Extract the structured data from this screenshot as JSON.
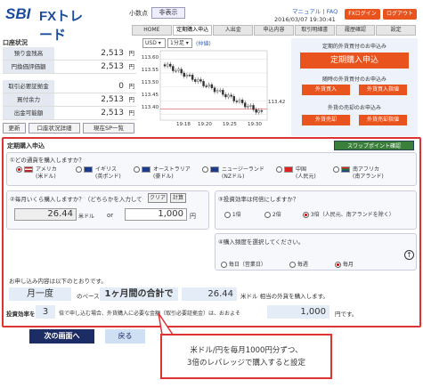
{
  "header": {
    "logo_sbi": "SBI",
    "logo_fx": "FXトレード",
    "decimal_label": "小数点",
    "decimal_toggle": "非表示",
    "links": "マニュアル | FAQ",
    "datetime": "2016/03/07 19:30:41",
    "red_btn1": "FXログイン",
    "red_btn2": "ログアウト"
  },
  "nav": {
    "tabs": [
      "HOME",
      "定期購入申込",
      "入出金",
      "申込内容",
      "取引明細書",
      "履歴確認",
      "設定"
    ]
  },
  "account": {
    "title": "口座状況",
    "rows": [
      {
        "label": "預り金残高",
        "value": "2,513",
        "unit": "円"
      },
      {
        "label": "円換価評価額",
        "value": "2,513",
        "unit": "円"
      },
      {
        "label": "取引必要証拠金",
        "value": "0",
        "unit": "円"
      },
      {
        "label": "買付余力",
        "value": "2,513",
        "unit": "円"
      },
      {
        "label": "出金可能額",
        "value": "2,513",
        "unit": "円"
      }
    ],
    "btn_update": "更新",
    "btn_details": "口座状況詳細",
    "btn_sp": "現在SP一覧"
  },
  "chart": {
    "pair": "USD",
    "period": "1分足",
    "mode": "(仲値)",
    "y_ticks": [
      "113.60",
      "113.55",
      "113.50",
      "113.45",
      "113.40"
    ],
    "x_ticks": [
      "19:18",
      "19:20",
      "19:25",
      "19:30"
    ],
    "last_price": "113.42"
  },
  "chart_data": {
    "type": "candlestick",
    "ylim": [
      113.38,
      113.63
    ],
    "y_ticks": [
      113.4,
      113.45,
      113.5,
      113.55,
      113.6
    ],
    "x_ticks": [
      "19:18",
      "19:20",
      "19:25",
      "19:30"
    ],
    "last_price": 113.42
  },
  "right_panel": {
    "title1": "定期的外貨買付のお申込み",
    "big_btn": "定期購入申込",
    "title2": "随時の外貨買付のお申込み",
    "btn_buy": "外貨買入",
    "btn_limit": "外貨買入指値",
    "title3": "外貨の売却のお申込み",
    "btn_sell": "外貨売却",
    "btn_sell_limit": "外貨売却指値"
  },
  "form": {
    "section_title": "定期購入申込",
    "swap_btn": "スワップポイント確認",
    "q1": "①どの通貨を購入しますか？",
    "currencies": [
      {
        "name": "アメリカ",
        "sub": "(米ドル)",
        "selected": true
      },
      {
        "name": "イギリス",
        "sub": "(英ポンド)",
        "selected": false
      },
      {
        "name": "オーストラリア",
        "sub": "(豪ドル)",
        "selected": false
      },
      {
        "name": "ニュージーランド",
        "sub": "(NZドル)",
        "selected": false
      },
      {
        "name": "中国",
        "sub": "(人民元)",
        "selected": false
      },
      {
        "name": "南アフリカ",
        "sub": "(南アランド)",
        "selected": false
      }
    ],
    "q2": "②毎月いくら購入しますか？（どちらかを入力してください）",
    "clear_btn": "クリア",
    "calc_btn": "計算",
    "amount_usd": "26.44",
    "usd_unit": "米ドル",
    "or": "or",
    "amount_jpy": "1,000",
    "jpy_unit": "円",
    "q3": "③投資効率は何倍にしますか？",
    "leverage": [
      {
        "label": "1倍",
        "selected": false
      },
      {
        "label": "2倍",
        "selected": false
      },
      {
        "label": "3倍（人民元、南アランドを除く）",
        "selected": true
      }
    ],
    "q4": "④購入頻度を選択してください。",
    "frequency": [
      {
        "label": "毎日（営業日）",
        "selected": false
      },
      {
        "label": "毎週",
        "selected": false
      },
      {
        "label": "毎月",
        "selected": true
      }
    ],
    "summary_intro": "お申し込み内容は以下のとおりです。",
    "freq_value": "月一度",
    "base_text": "のペースで、",
    "total_text": "1ヶ月間の合計で",
    "total_usd": "26.44",
    "total_suffix": "米ドル 相当の外貨を購入します。",
    "eff_label": "投資効率を",
    "eff_value": "3",
    "eff_text": "倍で申し込む場合、外貨購入に必要な金額（取引必要証拠金）は、おおよそ",
    "required": "1,000",
    "required_suffix": "円です。"
  },
  "bottom": {
    "next_btn": "次の画面へ",
    "back_btn": "戻る"
  },
  "callout": {
    "line1": "米ドル/円を毎月1000円分ずつ、",
    "line2": "3倍のレバレッジで購入すると設定"
  }
}
